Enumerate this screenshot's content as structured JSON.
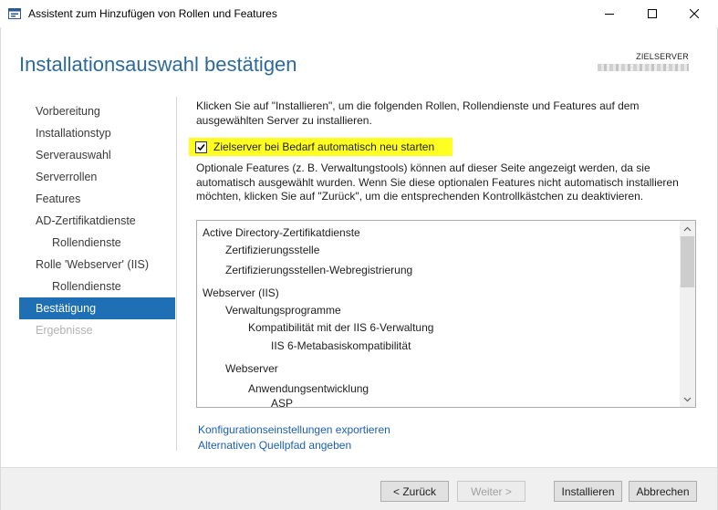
{
  "window": {
    "title": "Assistent zum Hinzufügen von Rollen und Features",
    "controls": [
      "minimize-icon",
      "maximize-icon",
      "close-icon"
    ]
  },
  "header": {
    "page_title": "Installationsauswahl bestätigen",
    "target_server_label": "ZIELSERVER"
  },
  "nav": {
    "items": [
      {
        "label": "Vorbereitung",
        "level": 0,
        "state": "normal"
      },
      {
        "label": "Installationstyp",
        "level": 0,
        "state": "normal"
      },
      {
        "label": "Serverauswahl",
        "level": 0,
        "state": "normal"
      },
      {
        "label": "Serverrollen",
        "level": 0,
        "state": "normal"
      },
      {
        "label": "Features",
        "level": 0,
        "state": "normal"
      },
      {
        "label": "AD-Zertifikatdienste",
        "level": 0,
        "state": "normal"
      },
      {
        "label": "Rollendienste",
        "level": 1,
        "state": "normal"
      },
      {
        "label": "Rolle 'Webserver' (IIS)",
        "level": 0,
        "state": "normal"
      },
      {
        "label": "Rollendienste",
        "level": 1,
        "state": "normal"
      },
      {
        "label": "Bestätigung",
        "level": 0,
        "state": "active"
      },
      {
        "label": "Ergebnisse",
        "level": 0,
        "state": "disabled"
      }
    ]
  },
  "content": {
    "intro": "Klicken Sie auf \"Installieren\", um die folgenden Rollen, Rollendienste und Features auf dem ausgewählten Server zu installieren.",
    "restart_checkbox": {
      "label": "Zielserver bei Bedarf automatisch neu starten",
      "checked": true
    },
    "optional_text": "Optionale Features (z. B. Verwaltungstools) können auf dieser Seite angezeigt werden, da sie automatisch ausgewählt wurden. Wenn Sie diese optionalen Features nicht automatisch installieren möchten, klicken Sie auf \"Zurück\", um die entsprechenden Kontrollkästchen zu deaktivieren.",
    "selection_list": [
      {
        "label": "Active Directory-Zertifikatdienste",
        "level": 0
      },
      {
        "label": "Zertifizierungsstelle",
        "level": 1
      },
      {
        "label": "Zertifizierungsstellen-Webregistrierung",
        "level": 1
      },
      {
        "label": "Webserver (IIS)",
        "level": 0
      },
      {
        "label": "Verwaltungsprogramme",
        "level": 1
      },
      {
        "label": "Kompatibilität mit der IIS 6-Verwaltung",
        "level": 2
      },
      {
        "label": "IIS 6-Metabasiskompatibilität",
        "level": 3
      },
      {
        "label": "Webserver",
        "level": 1
      },
      {
        "label": "Anwendungsentwicklung",
        "level": 2
      },
      {
        "label": "ASP",
        "level": 3
      }
    ],
    "links": {
      "export": "Konfigurationseinstellungen exportieren",
      "alt_source": "Alternativen Quellpfad angeben"
    }
  },
  "footer": {
    "back": "< Zurück",
    "next": "Weiter >",
    "install": "Installieren",
    "cancel": "Abbrechen"
  },
  "colors": {
    "title_blue": "#2d6a99",
    "nav_active": "#1e6fb3",
    "highlight_yellow": "#ffff22",
    "link_blue": "#1a5fb4"
  }
}
